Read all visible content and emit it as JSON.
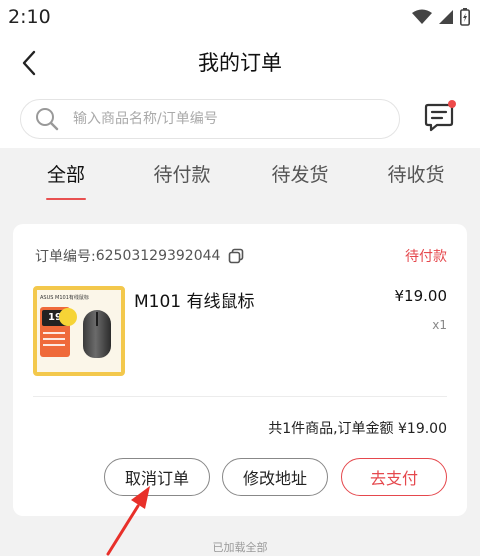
{
  "status_bar": {
    "time": "2:10",
    "icons": [
      "wifi-icon",
      "signal-icon",
      "battery-icon"
    ]
  },
  "header": {
    "title": "我的订单",
    "back_icon": "chevron-left-icon"
  },
  "search": {
    "placeholder": "输入商品名称/订单编号",
    "icon": "search-icon",
    "message_icon": "message-icon"
  },
  "tabs": [
    {
      "label": "全部",
      "active": true
    },
    {
      "label": "待付款",
      "active": false
    },
    {
      "label": "待发货",
      "active": false
    },
    {
      "label": "待收货",
      "active": false
    }
  ],
  "order": {
    "order_no_label": "订单编号:",
    "order_no": "62503129392044",
    "status": "待付款",
    "product": {
      "name": "M101 有线鼠标",
      "price": "¥19.00",
      "quantity": "x1",
      "image_text": "ASUS M101有线鼠标",
      "image_price": "19"
    },
    "summary": "共1件商品,订单金额 ¥19.00",
    "buttons": {
      "cancel": "取消订单",
      "modify_address": "修改地址",
      "pay": "去支付"
    }
  },
  "footer": {
    "loaded_text": "已加载全部"
  },
  "colors": {
    "accent": "#e5484d",
    "card_bg": "#ffffff",
    "page_bg": "#f2f2f2"
  }
}
